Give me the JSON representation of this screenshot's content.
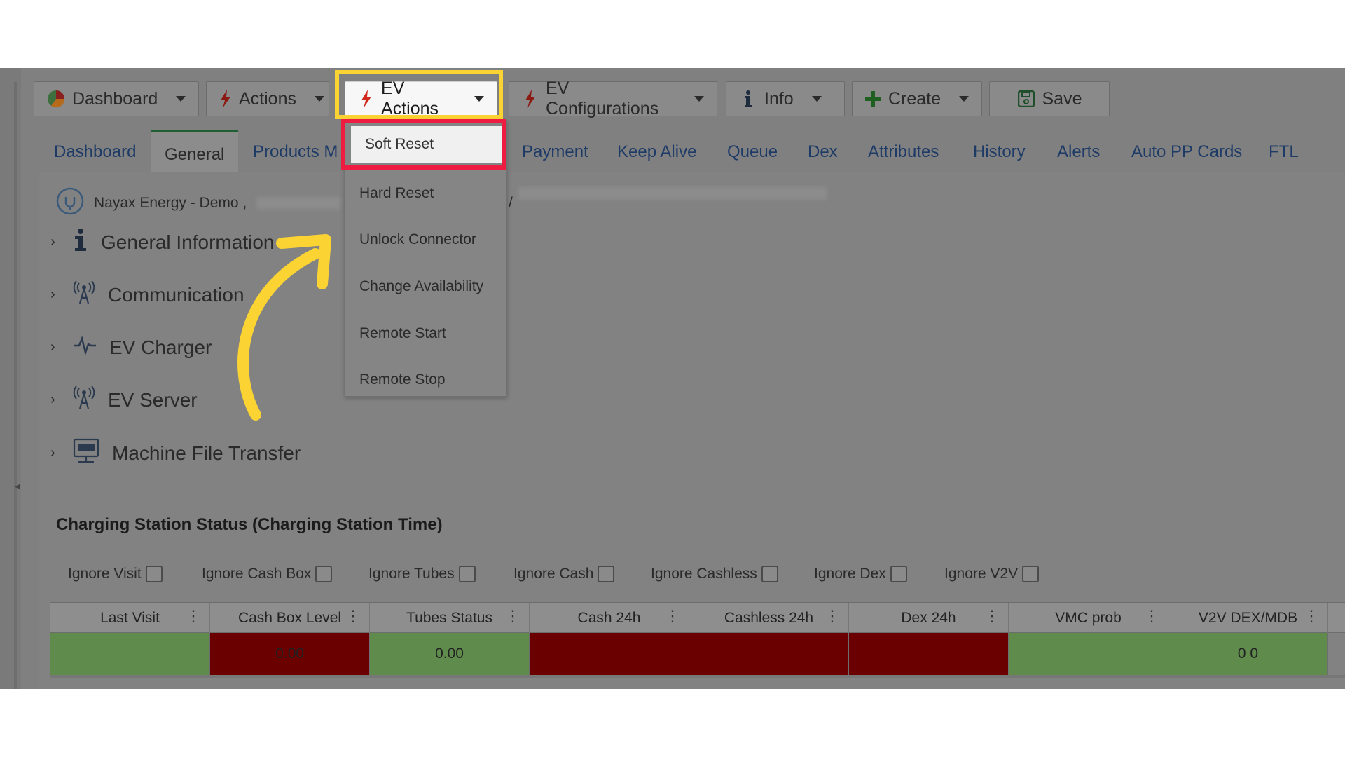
{
  "toolbar": {
    "dashboard_label": "Dashboard",
    "actions_label": "Actions",
    "ev_actions_label": "EV Actions",
    "ev_configurations_label": "EV Configurations",
    "info_label": "Info",
    "create_label": "Create",
    "save_label": "Save"
  },
  "tabs": [
    {
      "label": "Dashboard"
    },
    {
      "label": "General"
    },
    {
      "label": "Products M"
    },
    {
      "label": "Payment"
    },
    {
      "label": "Keep Alive"
    },
    {
      "label": "Queue"
    },
    {
      "label": "Dex"
    },
    {
      "label": "Attributes"
    },
    {
      "label": "History"
    },
    {
      "label": "Alerts"
    },
    {
      "label": "Auto PP Cards"
    },
    {
      "label": "FTL"
    }
  ],
  "breadcrumb": {
    "site": "Nayax Energy - Demo ,",
    "separator": "/"
  },
  "sections": [
    {
      "label": "General Information",
      "icon": "info-icon"
    },
    {
      "label": "Communication",
      "icon": "antenna-icon"
    },
    {
      "label": "EV Charger",
      "icon": "pulse-icon"
    },
    {
      "label": "EV Server",
      "icon": "antenna-icon"
    },
    {
      "label": "Machine File Transfer",
      "icon": "ftp-icon"
    }
  ],
  "ev_actions_menu": [
    {
      "label": "Soft Reset"
    },
    {
      "label": "Hard Reset"
    },
    {
      "label": "Unlock Connector"
    },
    {
      "label": "Change Availability"
    },
    {
      "label": "Remote Start"
    },
    {
      "label": "Remote Stop"
    }
  ],
  "status": {
    "title": "Charging Station Status (Charging Station Time)",
    "ignore_filters": [
      {
        "label": "Ignore Visit"
      },
      {
        "label": "Ignore Cash Box"
      },
      {
        "label": "Ignore Tubes"
      },
      {
        "label": "Ignore Cash"
      },
      {
        "label": "Ignore Cashless"
      },
      {
        "label": "Ignore Dex"
      },
      {
        "label": "Ignore V2V"
      }
    ],
    "columns": [
      {
        "label": "Last Visit"
      },
      {
        "label": "Cash Box Level"
      },
      {
        "label": "Tubes Status"
      },
      {
        "label": "Cash 24h"
      },
      {
        "label": "Cashless 24h"
      },
      {
        "label": "Dex 24h"
      },
      {
        "label": "VMC prob"
      },
      {
        "label": "V2V DEX/MDB"
      }
    ],
    "row": [
      {
        "value": "",
        "color": "#5f8b4c"
      },
      {
        "value": "0.00",
        "color": "#6b0000"
      },
      {
        "value": "0.00",
        "color": "#5f8b4c"
      },
      {
        "value": "",
        "color": "#6b0000"
      },
      {
        "value": "",
        "color": "#6b0000"
      },
      {
        "value": "",
        "color": "#6b0000"
      },
      {
        "value": "",
        "color": "#5f8b4c"
      },
      {
        "value": "0 0",
        "color": "#5f8b4c"
      }
    ]
  },
  "colors": {
    "highlight_yellow": "#fbd434",
    "highlight_red": "#ee1c40",
    "annotation_arrow": "#fbd434",
    "tab_link": "#1e3a66"
  }
}
